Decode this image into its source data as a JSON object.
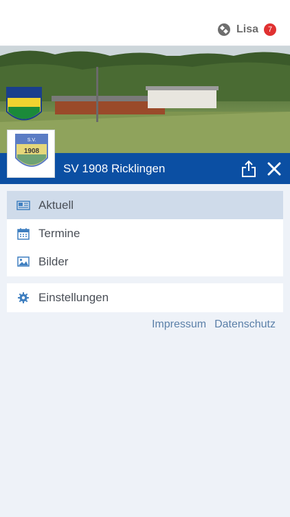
{
  "header": {
    "user_name": "Lisa",
    "notification_count": "7"
  },
  "club": {
    "name": "SV 1908 Ricklingen",
    "crest_text": "1908",
    "crest_sv": "S.V."
  },
  "menu": {
    "items": [
      {
        "label": "Aktuell",
        "icon": "newspaper-icon",
        "active": true
      },
      {
        "label": "Termine",
        "icon": "calendar-icon",
        "active": false
      },
      {
        "label": "Bilder",
        "icon": "image-icon",
        "active": false
      }
    ],
    "settings": {
      "label": "Einstellungen",
      "icon": "gear-icon"
    }
  },
  "footer_links": {
    "impressum": "Impressum",
    "datenschutz": "Datenschutz"
  },
  "colors": {
    "accent": "#0b4fa3",
    "active_row": "#cfdbea",
    "link": "#5a7fa8",
    "badge": "#e03131"
  }
}
